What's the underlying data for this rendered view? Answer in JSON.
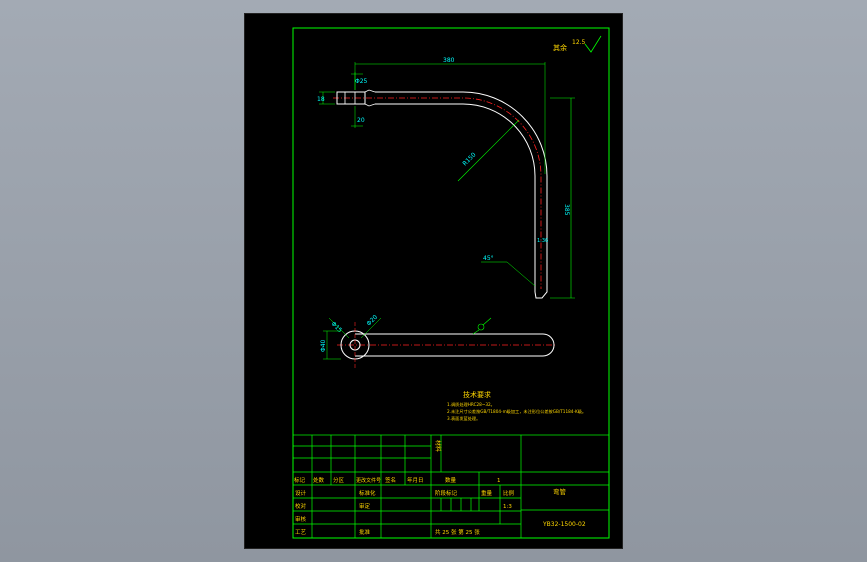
{
  "colors": {
    "viewport_bg": "#9aa1ab",
    "sheet_bg": "#000000",
    "frame": "#00ff00",
    "outline": "#ffffff",
    "centerline": "#ff2020",
    "dimension": "#00ff00",
    "text_yellow": "#ffd700",
    "text_cyan": "#00ffff"
  },
  "drawing": {
    "roughness_label": "其余",
    "roughness_value": "12.5",
    "dims": {
      "top_length": "380",
      "vertical_length": "385",
      "bend_radius": "R150",
      "end_dia_1": "Φ25",
      "end_dia_2": "20",
      "left_height": "18",
      "chamfer": "45°",
      "side_note": "1:36",
      "plan_dim_1": "Φ15",
      "plan_dim_2": "Φ20",
      "plan_width": "Φ40"
    },
    "tech_title": "技术要求",
    "tech_notes": [
      "1.调质处理HRC28~32。",
      "2.未注尺寸公差按GB/T1804-m级加工，未注形位公差按GB/T1184-K级。",
      "3.表面发蓝处理。"
    ]
  },
  "title_block": {
    "material_label": "材料",
    "rev_headers": [
      "标记",
      "处数",
      "分区",
      "更改文件号",
      "签名",
      "年月日"
    ],
    "roles": [
      "设计",
      "校对",
      "审核",
      "工艺"
    ],
    "std_label": "标准化",
    "approve_label": "审定",
    "ratify_label": "批准",
    "qty_label": "数量",
    "qty_value": "1",
    "stage_label": "阶段标记",
    "weight_label": "重量",
    "scale_label": "比例",
    "scale_value": "1:3",
    "sheet_info": "共 25 张 第 25 张",
    "part_name": "弯管",
    "drawing_no": "YB32-1500-02"
  }
}
